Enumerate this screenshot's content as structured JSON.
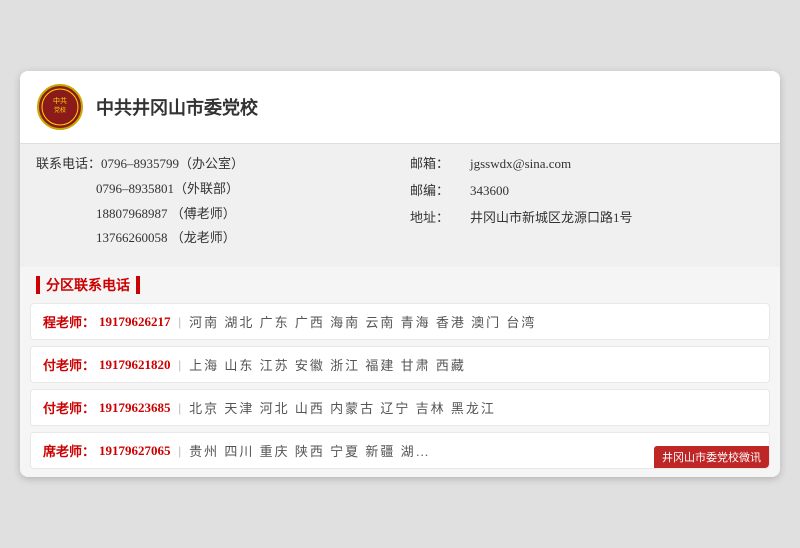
{
  "org": {
    "name": "中共井冈山市委党校",
    "logo_alt": "党校徽章"
  },
  "contact": {
    "label_phone": "联系电话：",
    "phone1": "0796–8935799（办公室）",
    "phone2": "0796–8935801（外联部）",
    "phone3": "18807968987  （傅老师）",
    "phone4": "13766260058  （龙老师）",
    "label_email": "邮箱：",
    "email": "jgsswdx@sina.com",
    "label_postcode": "邮编：",
    "postcode": "343600",
    "label_address": "地址：",
    "address": "井冈山市新城区龙源口路1号"
  },
  "section_title": "分区联系电话",
  "regions": [
    {
      "teacher": "程老师：",
      "phone": "19179626217",
      "areas": "河南  湖北  广东  广西  海南  云南  青海  香港  澳门  台湾"
    },
    {
      "teacher": "付老师：",
      "phone": "19179621820",
      "areas": "上海  山东  江苏  安徽  浙江  福建  甘肃  西藏"
    },
    {
      "teacher": "付老师：",
      "phone": "19179623685",
      "areas": "北京  天津  河北  山西  内蒙古  辽宁  吉林  黑龙江"
    },
    {
      "teacher": "席老师：",
      "phone": "19179627065",
      "areas": "贵州  四川  重庆  陕西  宁夏  新疆  湖…"
    }
  ],
  "watermark_text": "井冈山市委党校微讯"
}
